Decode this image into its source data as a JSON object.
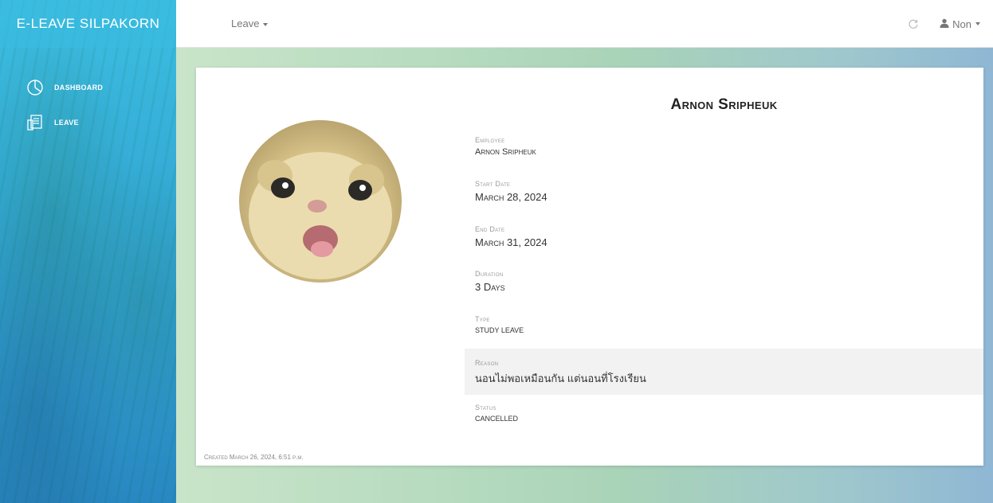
{
  "sidebar": {
    "brand": "E-LEAVE SILPAKORN",
    "items": [
      {
        "label": "DASHBOARD",
        "icon": "dashboard-icon"
      },
      {
        "label": "LEAVE",
        "icon": "leave-icon"
      }
    ]
  },
  "topbar": {
    "menu_label": "Leave",
    "user_name": "Non",
    "icons": [
      "refresh-icon",
      "user-icon",
      "chevron-down-icon"
    ]
  },
  "detail": {
    "title": "Arnon Sripheuk",
    "fields": [
      {
        "label": "Employee",
        "value": "Arnon Sripheuk"
      },
      {
        "label": "Start Date",
        "value": "March 28, 2024"
      },
      {
        "label": "End Date",
        "value": "March 31, 2024"
      },
      {
        "label": "Duration",
        "value": "3 Days"
      },
      {
        "label": "Type",
        "value": "STUDY LEAVE"
      },
      {
        "label": "Reason",
        "value": "นอนไม่พอเหมือนกัน แต่นอนที่โรงเรียน"
      },
      {
        "label": "Status",
        "value": "CANCELLED"
      }
    ],
    "created": "Created March 26, 2024, 6:51 p.m."
  },
  "colors": {
    "sidebar": "#3aa6d0",
    "card": "#ffffff",
    "highlight_row": "#f2f2f2"
  }
}
